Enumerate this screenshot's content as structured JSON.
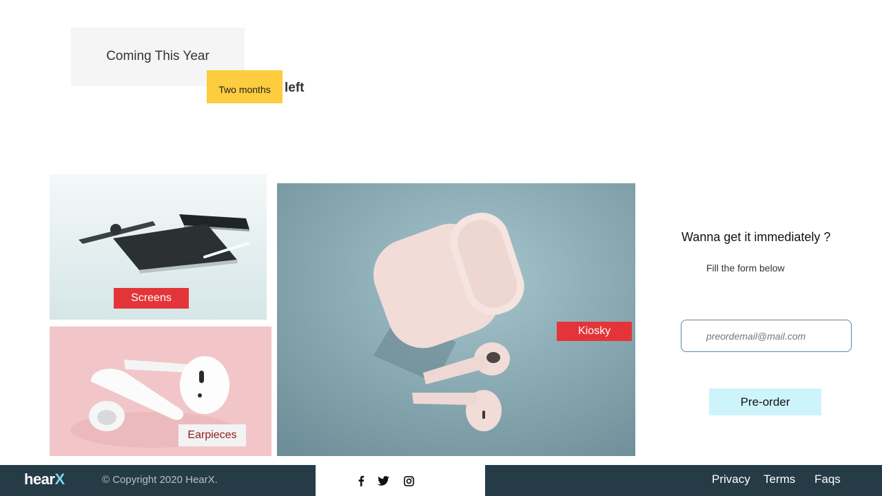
{
  "hero": {
    "coming_label": "Coming This Year",
    "badge_label": "Two months",
    "left_label": "left"
  },
  "gallery": {
    "screens_label": "Screens",
    "kiosky_label": "Kiosky",
    "earpieces_label": "Earpieces"
  },
  "preorder": {
    "title": "Wanna get it immediately ?",
    "subtitle": "Fill the form below",
    "email_placeholder": "preordemail@mail.com",
    "button_label": "Pre-order"
  },
  "footer": {
    "logo_main": "hear",
    "logo_accent": "X",
    "copyright": "© Copyright 2020 HearX.",
    "social": [
      "facebook-icon",
      "twitter-icon",
      "instagram-icon"
    ],
    "links": [
      "Privacy",
      "Terms",
      "Faqs"
    ]
  },
  "colors": {
    "accent_yellow": "#fdcc3f",
    "tag_red": "#e33539",
    "footer_dark": "#253b45",
    "button_cyan": "#cdf4fb",
    "logo_accent": "#7fd3e8"
  }
}
